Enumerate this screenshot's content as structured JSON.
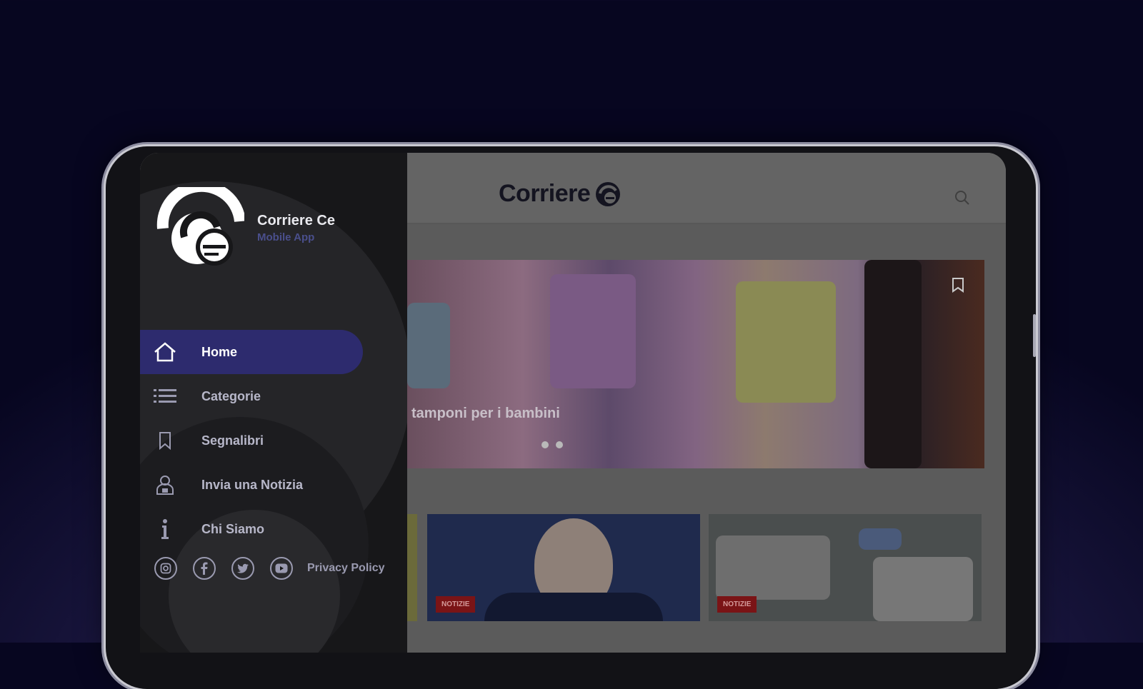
{
  "app": {
    "brand_wordmark": "Corriere",
    "drawer": {
      "title": "Corriere Ce",
      "subtitle": "Mobile App",
      "menu": [
        {
          "label": "Home",
          "icon": "home-icon",
          "active": true
        },
        {
          "label": "Categorie",
          "icon": "list-icon",
          "active": false
        },
        {
          "label": "Segnalibri",
          "icon": "bookmark-icon",
          "active": false
        },
        {
          "label": "Invia una Notizia",
          "icon": "person-icon",
          "active": false
        },
        {
          "label": "Chi Siamo",
          "icon": "info-icon",
          "active": false
        }
      ],
      "social": [
        "instagram-icon",
        "facebook-icon",
        "twitter-icon",
        "youtube-icon"
      ],
      "privacy_label": "Privacy Policy"
    },
    "slider": {
      "caption": "tamponi per i bambini",
      "dots": 2
    },
    "cards": [
      {
        "tag": "NOTIZIE"
      },
      {
        "tag": "NOTIZIE"
      }
    ],
    "colors": {
      "accent": "#2d2b6e",
      "drawer_bg": "#171719",
      "subtitle": "#4a4f8c",
      "tag": "#7a1416"
    }
  }
}
